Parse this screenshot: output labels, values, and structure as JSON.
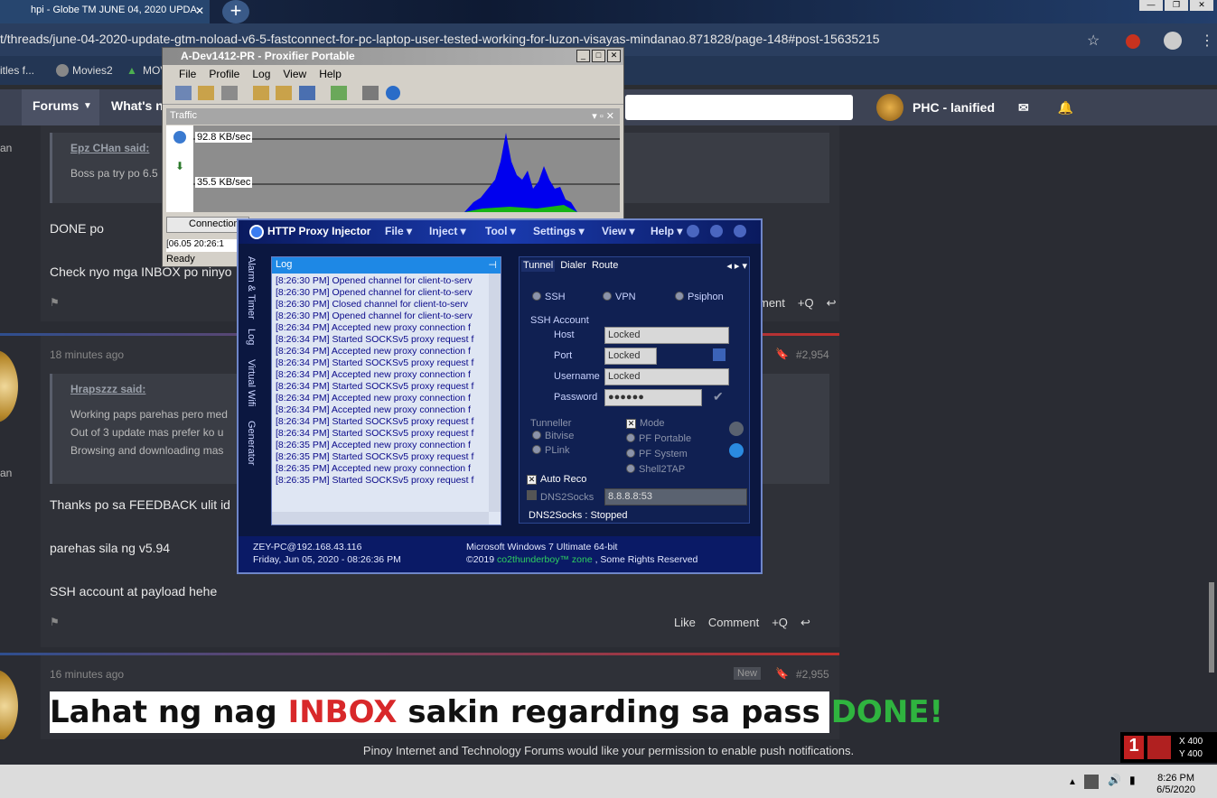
{
  "browser": {
    "tab_title": "hpi - Globe TM JUNE 04, 2020 UPDA",
    "url": "t/threads/june-04-2020-update-gtm-noload-v6-5-fastconnect-for-pc-laptop-user-tested-working-for-luzon-visayas-mindanao.871828/page-148#post-15635215",
    "bookmarks": [
      "itles f...",
      "Movies2",
      "MOV"
    ]
  },
  "forum": {
    "nav": [
      "Forums",
      "What's ne"
    ],
    "username": "PHC - lanified",
    "post1": {
      "quote_author": "Epz CHan said:",
      "quote_text": "Boss pa try po 6.5",
      "lines": [
        "DONE po",
        "Check nyo mga INBOX po ninyo"
      ],
      "actions": [
        "ment",
        "+Q"
      ]
    },
    "post2": {
      "time": "18 minutes ago",
      "number": "#2,954",
      "quote_author": "Hrapszzz said:",
      "quote_lines": [
        "Working paps parehas pero med",
        "Out of 3 update mas prefer ko u",
        "Browsing and downloading mas"
      ],
      "lines": [
        "Thanks po sa FEEDBACK ulit id",
        "parehas sila ng v5.94",
        "SSH account at payload hehe"
      ],
      "actions": [
        "Like",
        "Comment",
        "+Q"
      ]
    },
    "post3": {
      "time": "16 minutes ago",
      "badge": "New",
      "number": "#2,955"
    },
    "banner": {
      "p1": "Lahat ng nag ",
      "p2": "INBOX",
      "p3": " sakin regarding sa pass ",
      "p4": "DONE!"
    },
    "side_labels": [
      "an",
      "an"
    ]
  },
  "push_notice": "Pinoy Internet and Technology Forums would like your permission to enable push notifications.",
  "proxifier": {
    "title": "A-Dev1412-PR - Proxifier Portable",
    "menu": [
      "File",
      "Profile",
      "Log",
      "View",
      "Help"
    ],
    "traffic_label": "Traffic",
    "rate_high": "92.8 KB/sec",
    "rate_low": "35.5 KB/sec",
    "connections_tab": "Connection",
    "status": "Ready",
    "log_stub": "[06.05 20:26:1"
  },
  "hpi": {
    "title": "HTTP Proxy Injector",
    "menu": [
      "File",
      "Inject",
      "Tool",
      "Settings",
      "View",
      "Help"
    ],
    "side_tabs": [
      "Alarm & Timer",
      "Log",
      "Virtual Wifi",
      "Generator"
    ],
    "log_title": "Log",
    "log_lines": [
      "[8:26:30 PM] Opened channel for client-to-serv",
      "[8:26:30 PM] Opened channel for client-to-serv",
      "[8:26:30 PM] Closed channel for client-to-serv",
      "[8:26:30 PM] Opened channel for client-to-serv",
      "[8:26:34 PM] Accepted new proxy connection f",
      "[8:26:34 PM] Started SOCKSv5 proxy request f",
      "[8:26:34 PM] Accepted new proxy connection f",
      "[8:26:34 PM] Started SOCKSv5 proxy request f",
      "[8:26:34 PM] Accepted new proxy connection f",
      "[8:26:34 PM] Started SOCKSv5 proxy request f",
      "[8:26:34 PM] Accepted new proxy connection f",
      "[8:26:34 PM] Accepted new proxy connection f",
      "[8:26:34 PM] Started SOCKSv5 proxy request f",
      "[8:26:34 PM] Started SOCKSv5 proxy request f",
      "[8:26:35 PM] Accepted new proxy connection f",
      "[8:26:35 PM] Started SOCKSv5 proxy request f",
      "[8:26:35 PM] Accepted new proxy connection f",
      "[8:26:35 PM] Started SOCKSv5 proxy request f"
    ],
    "tabs": [
      "Tunnel",
      "Dialer",
      "Route"
    ],
    "modes": [
      "SSH",
      "VPN",
      "Psiphon"
    ],
    "ssh_account": "SSH Account",
    "host_label": "Host",
    "host": "Locked",
    "port_label": "Port",
    "port": "Locked",
    "user_label": "Username",
    "user": "Locked",
    "pass_label": "Password",
    "pass": "●●●●●●",
    "tunneller": "Tunneller",
    "tunnellers": [
      "Bitvise",
      "PLink"
    ],
    "mode_label": "Mode",
    "mode_opts": [
      "PF Portable",
      "PF System",
      "Shell2TAP"
    ],
    "auto_reco": "Auto Reco",
    "dns_label": "DNS2Socks",
    "dns_value": "8.8.8.8:53",
    "dns_status": "DNS2Socks : Stopped",
    "foot_pc": "ZEY-PC@192.168.43.116",
    "foot_date": "Friday, Jun 05, 2020 - 08:26:36 PM",
    "foot_os": "Microsoft Windows 7 Ultimate  64-bit",
    "foot_c1": "©2019 ",
    "foot_c2": "co2thunderboy™ zone",
    "foot_c3": " , Some Rights Reserved"
  },
  "taskbar": {
    "time": "8:26 PM",
    "date": "6/5/2020"
  },
  "mouse": {
    "x": "X 400",
    "y": "Y 400"
  }
}
